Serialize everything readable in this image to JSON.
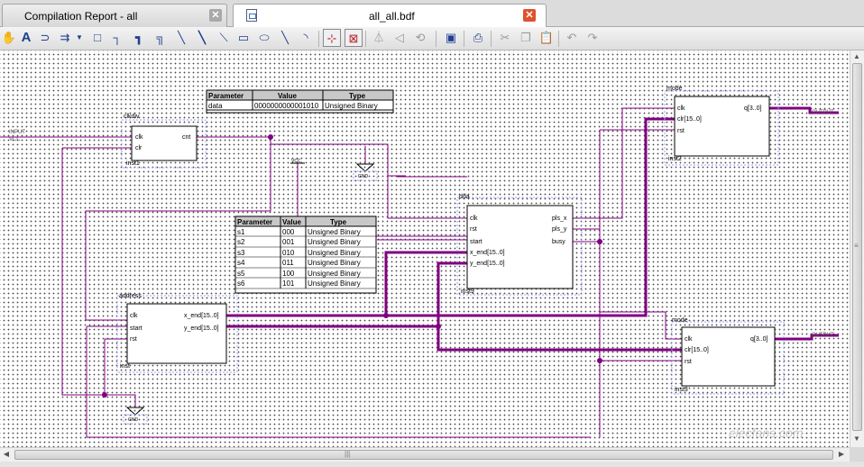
{
  "tabs": [
    {
      "label": "Compilation Report - all",
      "active": false
    },
    {
      "label": "all_all.bdf",
      "active": true
    }
  ],
  "toolbar": {
    "tools": [
      "hand-icon",
      "text-icon",
      "symbol-icon",
      "pin-icon",
      "dropdown-icon",
      "block-icon",
      "orthogonal-node-icon",
      "orthogonal-bus-icon",
      "orthogonal-conduit-icon",
      "diagonal-node-icon",
      "diagonal-bus-icon",
      "rectangle-icon",
      "oval-icon",
      "line-icon",
      "arc-icon",
      "rubberbanding-icon",
      "partial-line-select-icon",
      "flip-horizontal-icon",
      "flip-vertical-icon",
      "rotate-icon",
      "save-icon",
      "print-icon",
      "cut-icon",
      "copy-icon",
      "paste-icon",
      "undo-icon",
      "redo-icon"
    ]
  },
  "params_top": {
    "headers": [
      "Parameter",
      "Value",
      "Type"
    ],
    "rows": [
      [
        "data",
        "0000000000001010",
        "Unsigned Binary"
      ]
    ]
  },
  "params_mid": {
    "headers": [
      "Parameter",
      "Value",
      "Type"
    ],
    "rows": [
      [
        "s1",
        "000",
        "Unsigned Binary"
      ],
      [
        "s2",
        "001",
        "Unsigned Binary"
      ],
      [
        "s3",
        "010",
        "Unsigned Binary"
      ],
      [
        "s4",
        "011",
        "Unsigned Binary"
      ],
      [
        "s5",
        "100",
        "Unsigned Binary"
      ],
      [
        "s6",
        "101",
        "Unsigned Binary"
      ]
    ]
  },
  "blocks": {
    "clkdiv": {
      "name": "clkdiv",
      "inst": "inst1",
      "ports_left": [
        "clk",
        "clr"
      ],
      "ports_right": [
        "cnt"
      ]
    },
    "dda": {
      "name": "dda",
      "inst": "inst9",
      "ports_left": [
        "clk",
        "rst",
        "start",
        "x_end[15..0]",
        "y_end[15..0]"
      ],
      "ports_right": [
        "pls_x",
        "pls_y",
        "busy"
      ]
    },
    "address": {
      "name": "address",
      "inst": "inst",
      "ports_left": [
        "clk",
        "start",
        "rst"
      ],
      "ports_right": [
        "x_end[15..0]",
        "y_end[15..0]"
      ]
    },
    "mode_top": {
      "name": "mode",
      "inst": "inst2",
      "ports_left": [
        "clk",
        "clr[15..0]",
        "rst"
      ],
      "ports_right": [
        "q[3..0]"
      ]
    },
    "mode_bot": {
      "name": "mode",
      "inst": "inst3",
      "ports_left": [
        "clk",
        "clr[15..0]",
        "rst"
      ],
      "ports_right": [
        "q[3..0]"
      ]
    }
  },
  "pins": {
    "input": "INPUT",
    "vcc": "VCC",
    "vcc2": "VCC",
    "gnd": "GND",
    "output1": "OUTPUT",
    "output2": "OUTPUT"
  },
  "watermark": "elecfans.com"
}
